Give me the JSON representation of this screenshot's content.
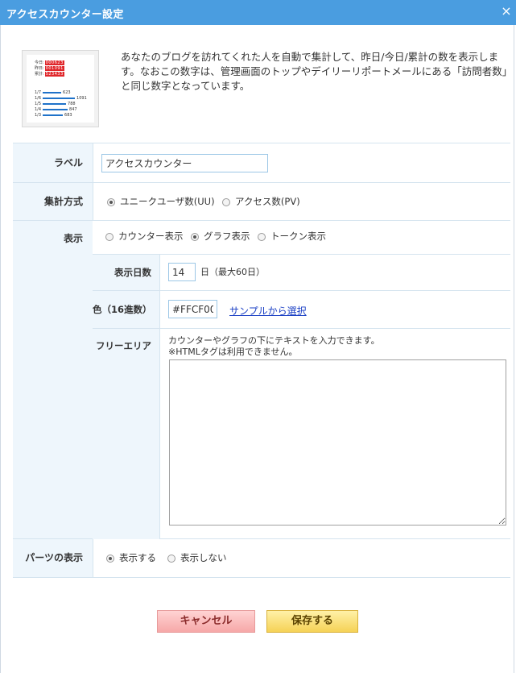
{
  "window": {
    "title": "アクセスカウンター設定",
    "close_glyph": "×"
  },
  "preview": {
    "counter_rows": [
      {
        "label": "今日:",
        "digits": "000623"
      },
      {
        "label": "昨日:",
        "digits": "001091"
      },
      {
        "label": "累計:",
        "digits": "523433"
      }
    ],
    "graph_rows": [
      {
        "date": "1/7",
        "value": "623",
        "fraction": 0.57
      },
      {
        "date": "1/6",
        "value": "1091",
        "fraction": 1.0
      },
      {
        "date": "1/5",
        "value": "788",
        "fraction": 0.72
      },
      {
        "date": "1/4",
        "value": "847",
        "fraction": 0.78
      },
      {
        "date": "1/3",
        "value": "683",
        "fraction": 0.63
      }
    ]
  },
  "description": "あなたのブログを訪れてくれた人を自動で集計して、昨日/今日/累計の数を表示します。なおこの数字は、管理画面のトップやデイリーリポートメールにある「訪問者数」と同じ数字となっています。",
  "form": {
    "label": {
      "title": "ラベル",
      "value": "アクセスカウンター"
    },
    "method": {
      "title": "集計方式",
      "options": [
        {
          "label": "ユニークユーザ数(UU)",
          "selected": true
        },
        {
          "label": "アクセス数(PV)",
          "selected": false
        }
      ]
    },
    "display": {
      "title": "表示",
      "options": [
        {
          "label": "カウンター表示",
          "selected": false
        },
        {
          "label": "グラフ表示",
          "selected": true
        },
        {
          "label": "トークン表示",
          "selected": false
        }
      ],
      "days": {
        "title": "表示日数",
        "value": "14",
        "suffix": "日（最大60日）"
      },
      "color": {
        "title": "色（16進数）",
        "value": "#FFCF00",
        "link": "サンプルから選択"
      },
      "free_area": {
        "title": "フリーエリア",
        "note_line1": "カウンターやグラフの下にテキストを入力できます。",
        "note_line2": "※HTMLタグは利用できません。",
        "value": ""
      }
    },
    "parts_display": {
      "title": "パーツの表示",
      "options": [
        {
          "label": "表示する",
          "selected": true
        },
        {
          "label": "表示しない",
          "selected": false
        }
      ]
    }
  },
  "buttons": {
    "cancel": "キャンセル",
    "save": "保存する"
  }
}
